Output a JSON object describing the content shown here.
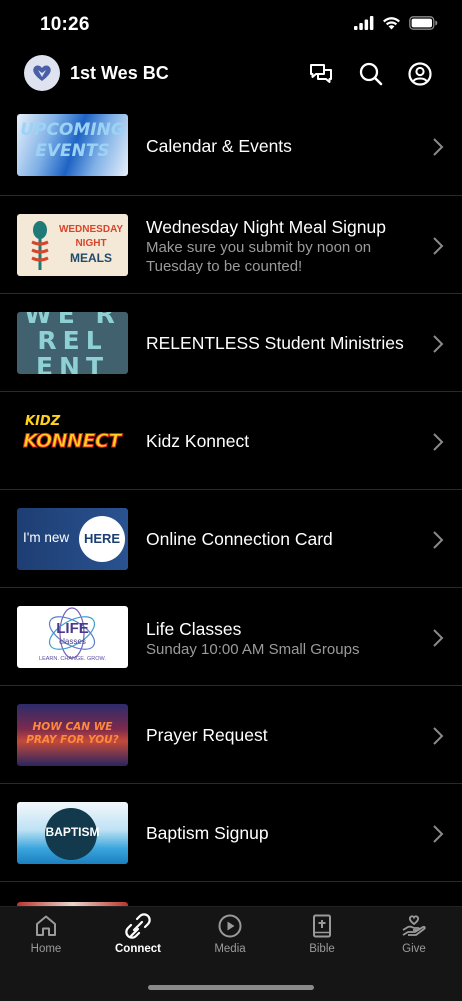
{
  "status": {
    "time": "10:26"
  },
  "header": {
    "title": "1st Wes BC"
  },
  "items": [
    {
      "title": "Calendar & Events",
      "subtitle": "",
      "thumb_text": [
        "UPCOMING",
        "EVENTS"
      ]
    },
    {
      "title": "Wednesday Night Meal Signup",
      "subtitle": "Make sure you submit by noon on Tuesday to be counted!",
      "thumb_text": [
        "WEDNESDAY",
        "NIGHT",
        "MEALS"
      ]
    },
    {
      "title": "RELENTLESS Student Ministries",
      "subtitle": "",
      "thumb_text": [
        "WE R",
        "REL",
        "ENT"
      ]
    },
    {
      "title": "Kidz Konnect",
      "subtitle": "",
      "thumb_text": [
        "KIDZ",
        "KONNECT"
      ]
    },
    {
      "title": "Online Connection Card",
      "subtitle": "",
      "thumb_text": [
        "I'm new",
        "HERE"
      ]
    },
    {
      "title": "Life Classes",
      "subtitle": "Sunday 10:00 AM Small Groups",
      "thumb_text": [
        "LIFE",
        "classes",
        "LEARN. CHANGE. GROW."
      ]
    },
    {
      "title": "Prayer Request",
      "subtitle": "",
      "thumb_text": [
        "HOW CAN WE",
        "PRAY FOR YOU?"
      ]
    },
    {
      "title": "Baptism Signup",
      "subtitle": "",
      "thumb_text": [
        "BAPTISM"
      ]
    }
  ],
  "tabs": [
    {
      "label": "Home",
      "icon": "home-icon",
      "active": false
    },
    {
      "label": "Connect",
      "icon": "connect-icon",
      "active": true
    },
    {
      "label": "Media",
      "icon": "play-icon",
      "active": false
    },
    {
      "label": "Bible",
      "icon": "bible-icon",
      "active": false
    },
    {
      "label": "Give",
      "icon": "give-icon",
      "active": false
    }
  ],
  "colors": {
    "background": "#000000",
    "tabbar": "#151515",
    "subtitle": "#9b9b9b",
    "divider": "#2a2a2a"
  }
}
